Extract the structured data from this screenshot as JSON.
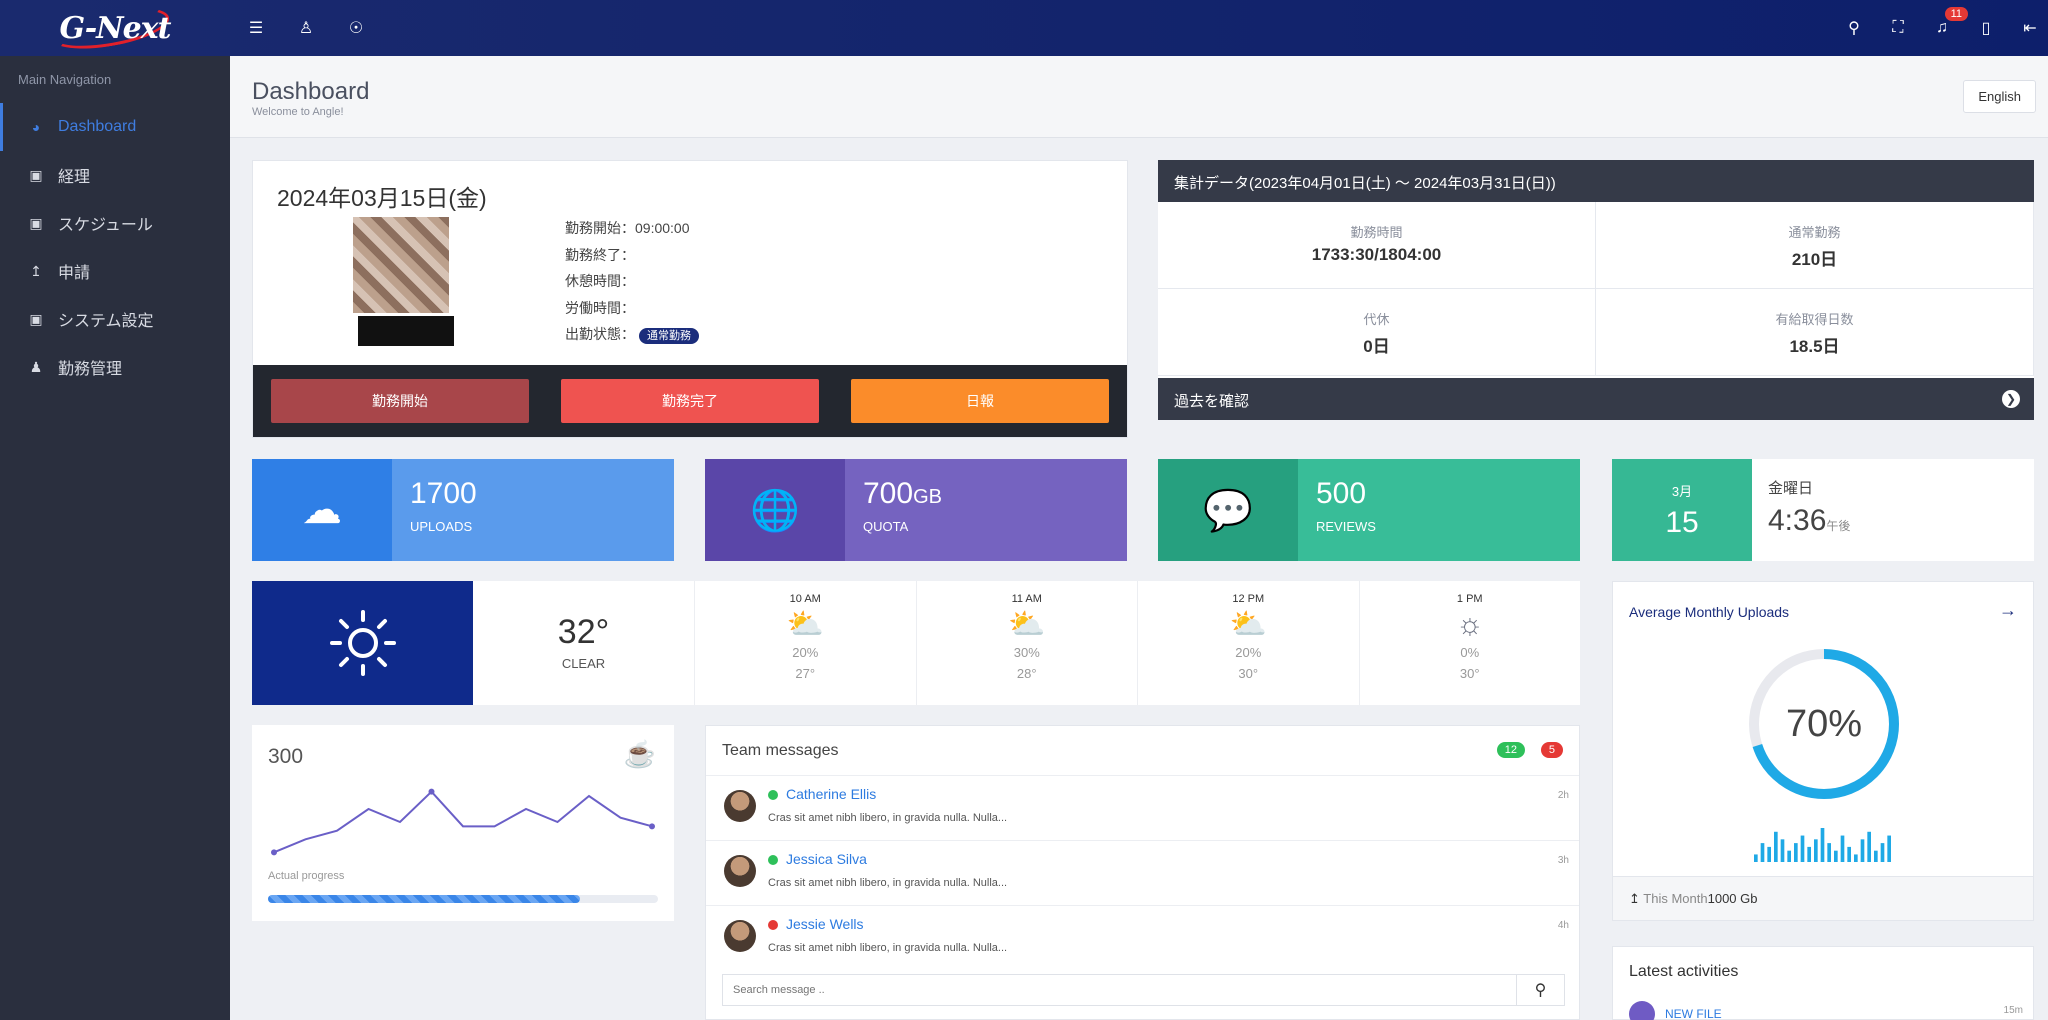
{
  "topbar": {
    "logo_text": "G-Next",
    "left_icons": [
      "menu-icon",
      "user-icon",
      "lock-icon"
    ],
    "right_icons": [
      "search-icon",
      "fullscreen-icon",
      "bell-icon",
      "panel-icon",
      "logout-icon"
    ],
    "notification_count": "11"
  },
  "sidebar": {
    "heading": "Main Navigation",
    "items": [
      {
        "label": "Dashboard",
        "icon": "gauge-icon",
        "active": true
      },
      {
        "label": "経理",
        "icon": "stack-icon"
      },
      {
        "label": "スケジュール",
        "icon": "stack-icon"
      },
      {
        "label": "申請",
        "icon": "upload-icon"
      },
      {
        "label": "システム設定",
        "icon": "stack-icon"
      },
      {
        "label": "勤務管理",
        "icon": "person-icon"
      }
    ]
  },
  "page": {
    "title": "Dashboard",
    "subtitle": "Welcome to Angle!",
    "language": "English"
  },
  "profile": {
    "date": "2024年03月15日(金)",
    "fields": [
      {
        "label": "勤務開始：",
        "value": "09:00:00"
      },
      {
        "label": "勤務終了：",
        "value": ""
      },
      {
        "label": "休憩時間：",
        "value": ""
      },
      {
        "label": "労働時間：",
        "value": ""
      },
      {
        "label": "出勤状態：",
        "value": "通常勤務"
      }
    ],
    "buttons": [
      {
        "label": "勤務開始",
        "color": "#a8464a"
      },
      {
        "label": "勤務完了",
        "color": "#ef5350"
      },
      {
        "label": "日報",
        "color": "#fb8c2a"
      }
    ]
  },
  "summary": {
    "title": "集計データ(2023年04月01日(土) ～ 2024年03月31日(日))",
    "cells": [
      {
        "label": "勤務時間",
        "value": "1733:30/1804:00"
      },
      {
        "label": "通常勤務",
        "value": "210日"
      },
      {
        "label": "代休",
        "value": "0日"
      },
      {
        "label": "有給取得日数",
        "value": "18.5日"
      }
    ],
    "footer": "過去を確認"
  },
  "stats": [
    {
      "value": "1700",
      "unit": "",
      "label": "UPLOADS",
      "icon": "cloud-upload-icon",
      "dark": "#2f7fe6",
      "light": "#5a9bec"
    },
    {
      "value": "700",
      "unit": "GB",
      "label": "QUOTA",
      "icon": "globe-icon",
      "dark": "#5a46a8",
      "light": "#7563c0"
    },
    {
      "value": "500",
      "unit": "",
      "label": "REVIEWS",
      "icon": "chat-icon",
      "dark": "#26a07f",
      "light": "#38bd98"
    }
  ],
  "date_widget": {
    "month": "3月",
    "day": "15",
    "weekday": "金曜日",
    "time": "4:36",
    "ampm": "午後"
  },
  "weather": {
    "now_temp": "32°",
    "now_cond": "CLEAR",
    "slots": [
      {
        "time": "10 AM",
        "pct": "20%",
        "temp": "27°"
      },
      {
        "time": "11 AM",
        "pct": "30%",
        "temp": "28°"
      },
      {
        "time": "12 PM",
        "pct": "20%",
        "temp": "30°"
      },
      {
        "time": "1 PM",
        "pct": "0%",
        "temp": "30°"
      }
    ]
  },
  "progress": {
    "value": "300",
    "label": "Actual progress",
    "fraction": 0.8
  },
  "chart_data": {
    "type": "line",
    "x": [
      0,
      1,
      2,
      3,
      4,
      5,
      6,
      7,
      8,
      9,
      10,
      11,
      12
    ],
    "values": [
      2,
      5,
      7,
      12,
      9,
      16,
      8,
      8,
      12,
      9,
      15,
      10,
      8
    ],
    "ylim": [
      0,
      18
    ],
    "title": "",
    "xlabel": "",
    "ylabel": ""
  },
  "team": {
    "title": "Team messages",
    "count_green": "12",
    "count_red": "5",
    "messages": [
      {
        "name": "Catherine Ellis",
        "text": "Cras sit amet nibh libero, in gravida nulla. Nulla...",
        "ago": "2h",
        "status": "#2ec05a"
      },
      {
        "name": "Jessica Silva",
        "text": "Cras sit amet nibh libero, in gravida nulla. Nulla...",
        "ago": "3h",
        "status": "#2ec05a"
      },
      {
        "name": "Jessie Wells",
        "text": "Cras sit amet nibh libero, in gravida nulla. Nulla...",
        "ago": "4h",
        "status": "#e53935"
      }
    ],
    "search_placeholder": "Search message .."
  },
  "avg_uploads": {
    "title": "Average Monthly Uploads",
    "percent": "70%",
    "fraction": 0.7,
    "bars": [
      2,
      5,
      4,
      8,
      6,
      3,
      5,
      7,
      4,
      6,
      9,
      5,
      3,
      7,
      4,
      2,
      6,
      8,
      3,
      5,
      7
    ],
    "footer_label": "This Month",
    "footer_value": "1000 Gb"
  },
  "activities": {
    "title": "Latest activities",
    "first_item": "NEW FILE",
    "first_ago": "15m"
  }
}
